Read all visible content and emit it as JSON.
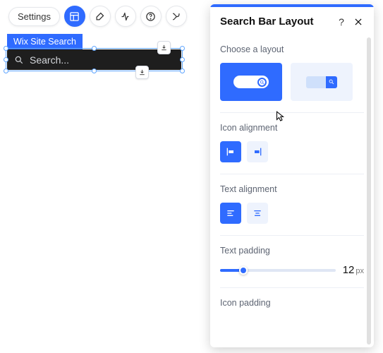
{
  "toolbar": {
    "settings_label": "Settings"
  },
  "canvas": {
    "badge_label": "Wix Site Search",
    "search_placeholder": "Search..."
  },
  "panel": {
    "title": "Search Bar Layout",
    "sections": {
      "layout": {
        "label": "Choose a layout"
      },
      "icon_align": {
        "label": "Icon alignment"
      },
      "text_align": {
        "label": "Text alignment"
      },
      "text_padding": {
        "label": "Text padding",
        "value": "12",
        "unit": "px",
        "percent": 20
      },
      "icon_padding": {
        "label": "Icon padding"
      }
    }
  }
}
